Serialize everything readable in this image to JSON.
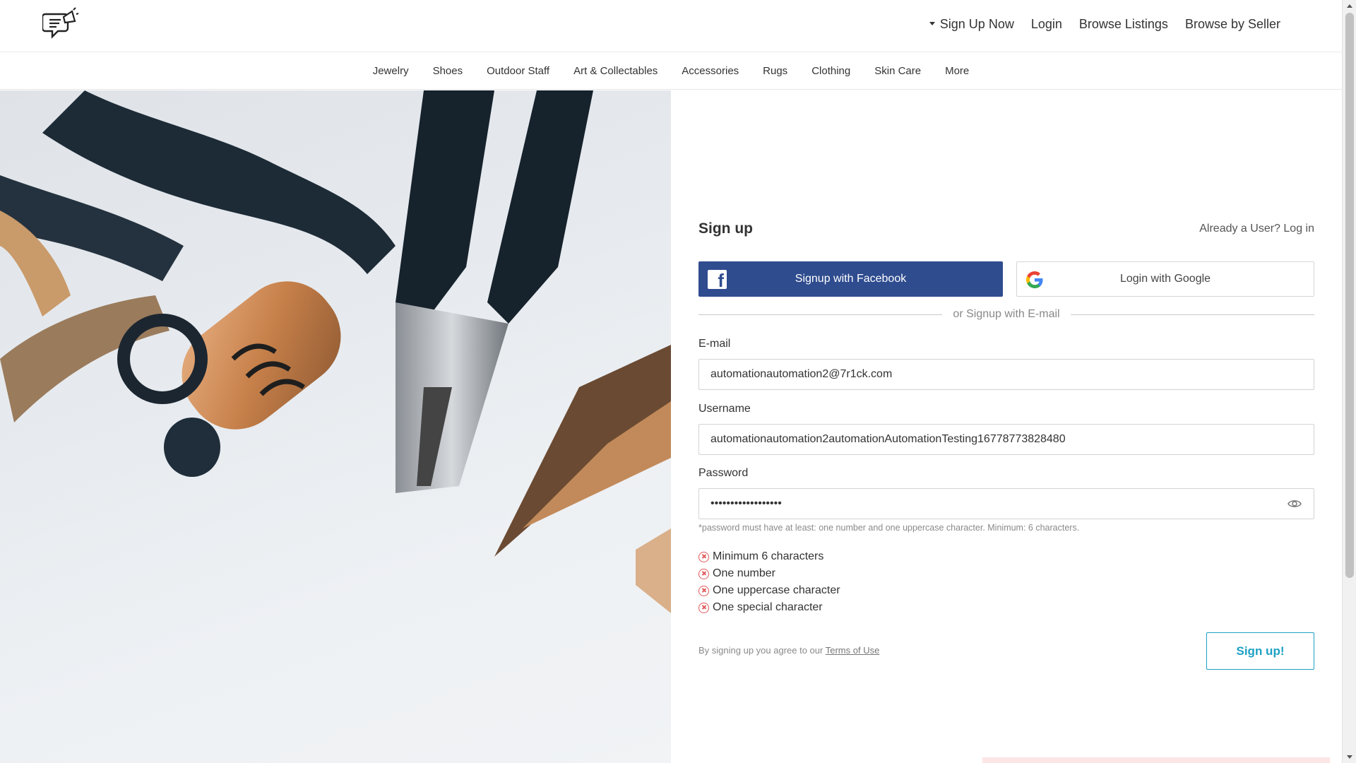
{
  "header": {
    "nav": {
      "signup": "Sign Up Now",
      "login": "Login",
      "browse_listings": "Browse Listings",
      "browse_by_seller": "Browse by Seller"
    }
  },
  "categories": [
    "Jewelry",
    "Shoes",
    "Outdoor Staff",
    "Art & Collectables",
    "Accessories",
    "Rugs",
    "Clothing",
    "Skin Care",
    "More"
  ],
  "form": {
    "title": "Sign up",
    "already_user": "Already a User? Log in",
    "facebook_label": "Signup with Facebook",
    "google_label": "Login with Google",
    "divider": "or Signup with E-mail",
    "email_label": "E-mail",
    "email_value": "automationautomation2@7r1ck.com",
    "username_label": "Username",
    "username_value": "automationautomation2automationAutomationTesting16778773828480",
    "password_label": "Password",
    "password_value": "••••••••••••••••••",
    "password_hint": "*password must have at least: one number and one uppercase character. Minimum: 6 characters.",
    "rules": [
      "Minimum 6 characters",
      "One number",
      "One uppercase character",
      "One special character"
    ],
    "terms_prefix": "By signing up you agree to our",
    "terms_link": "Terms of Use",
    "submit": "Sign up!"
  },
  "colors": {
    "facebook": "#2f4c8f",
    "accent": "#1ea0c3",
    "error": "#e05a5a"
  },
  "icons": {
    "logo": "megaphone-chat-logo",
    "facebook": "facebook-icon",
    "google": "google-icon",
    "password_toggle": "eye-icon",
    "rule_status": "x-circle-icon"
  }
}
